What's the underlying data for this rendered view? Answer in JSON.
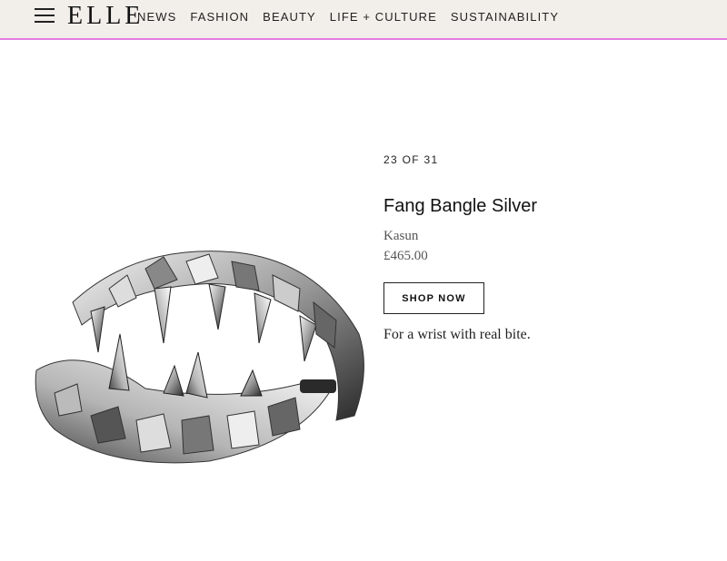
{
  "header": {
    "logo": "ELLE",
    "nav": [
      "NEWS",
      "FASHION",
      "BEAUTY",
      "LIFE + CULTURE",
      "SUSTAINABILITY"
    ],
    "accent_color": "#e47ee3",
    "menu_icon": "hamburger-menu-icon"
  },
  "slide": {
    "counter": "23 OF 31",
    "title": "Fang Bangle Silver",
    "brand": "Kasun",
    "price": "£465.00",
    "shop_label": "SHOP NOW",
    "description": "For a wrist with real bite."
  },
  "image": {
    "subject": "silver spiked fang bangle"
  }
}
